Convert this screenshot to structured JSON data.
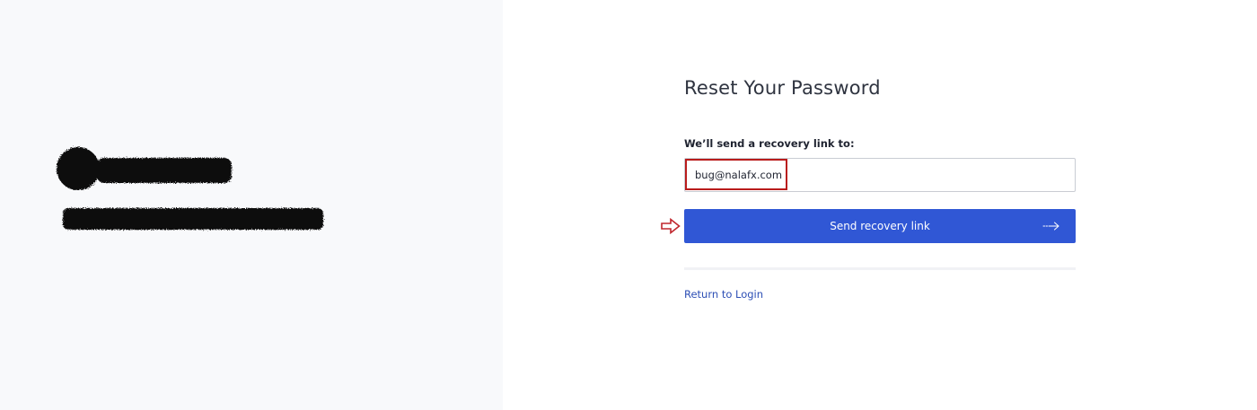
{
  "left_panel": {
    "logo_alt": "redacted logo"
  },
  "form": {
    "title": "Reset Your Password",
    "field_label": "We’ll send a recovery link to:",
    "email_value": "bug@nalafx.com",
    "submit_label": "Send recovery link",
    "return_link": "Return to Login"
  },
  "colors": {
    "primary": "#3057d5",
    "link": "#2d4fb5",
    "highlight": "#b91c1c",
    "left_background": "#f8f9fb"
  },
  "icons": {
    "submit": "arrow-right-icon",
    "pointer": "annotation-arrow-icon"
  }
}
